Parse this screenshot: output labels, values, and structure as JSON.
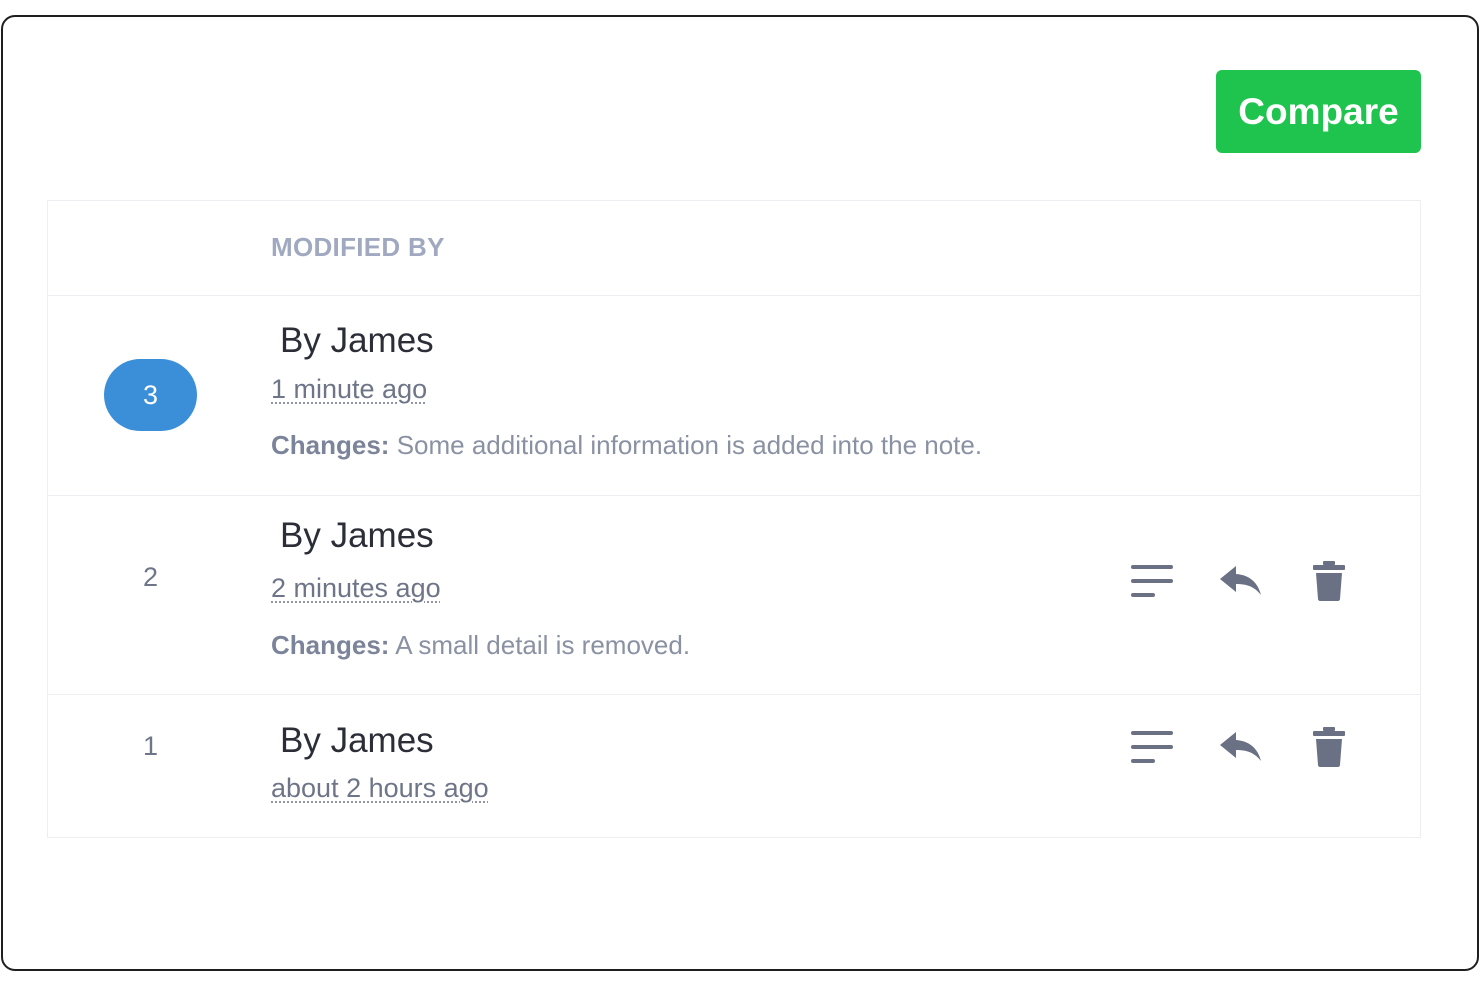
{
  "toolbar": {
    "compare_label": "Compare"
  },
  "table": {
    "header": {
      "modified_by": "MODIFIED BY"
    },
    "changes_label": "Changes:",
    "rows": [
      {
        "version": "3",
        "author": "By James",
        "time": "1 minute ago",
        "changes": "Some additional information is added into the note.",
        "current": true
      },
      {
        "version": "2",
        "author": "By James",
        "time": "2 minutes ago",
        "changes": "A small detail is removed.",
        "current": false
      },
      {
        "version": "1",
        "author": "By James",
        "time": "about 2 hours ago",
        "current": false
      }
    ]
  },
  "icons": {
    "view": "lines-icon",
    "restore": "reply-icon",
    "delete": "trash-icon"
  },
  "colors": {
    "compare_button": "#1fc44f",
    "current_badge": "#3b8fd8",
    "icon": "#6b7185"
  }
}
